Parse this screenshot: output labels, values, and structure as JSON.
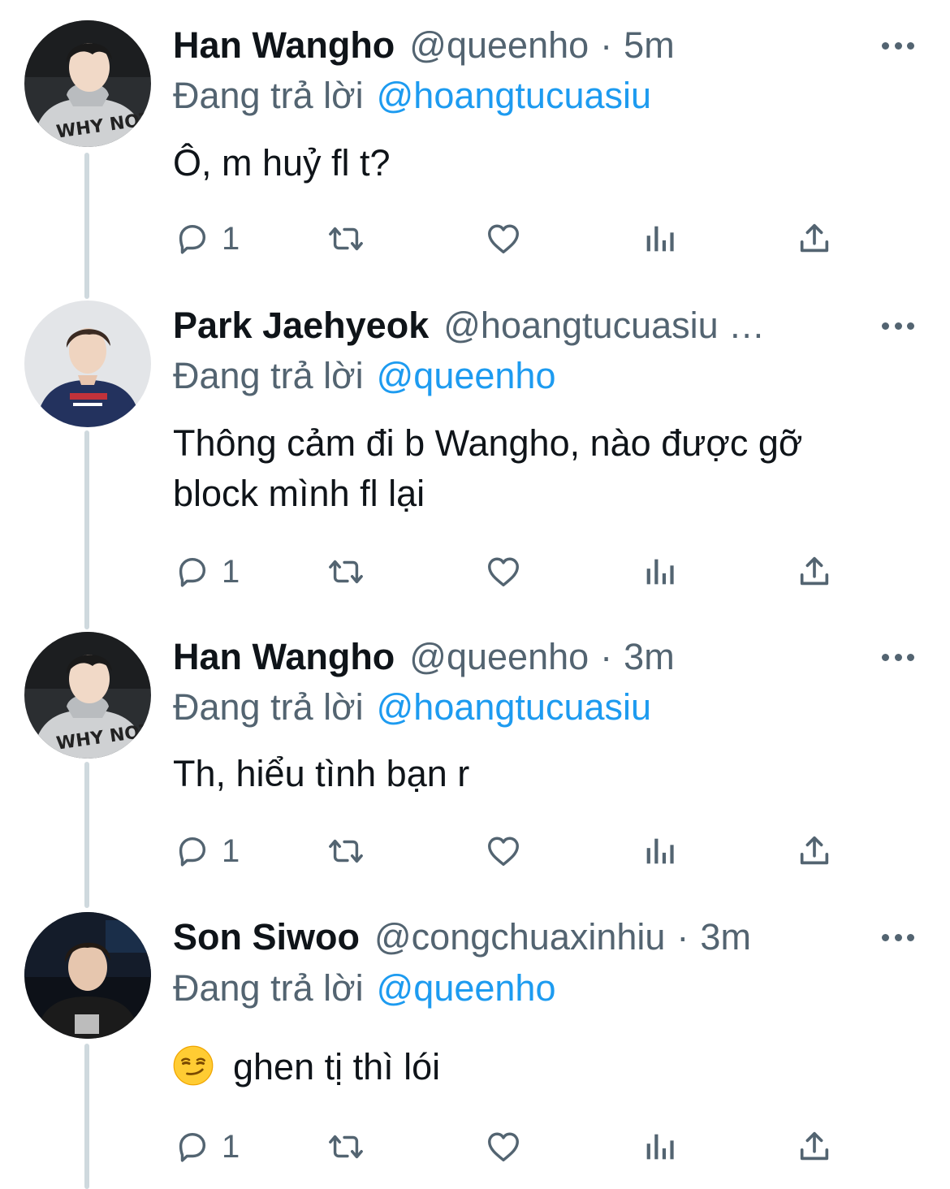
{
  "colors": {
    "text": "#0f1419",
    "secondary": "#536471",
    "link": "#1d9bf0",
    "thread_line": "#cfd9de"
  },
  "tweets": [
    {
      "display_name": "Han Wangho",
      "handle": "@queenho",
      "dot": "·",
      "time": "5m",
      "reply_label": "Đang trả lời",
      "reply_handle": "@hoangtucuasiu",
      "text": "Ô, m huỷ fl t?",
      "reply_count": "1",
      "avatar": "avatar-han-wangho"
    },
    {
      "display_name": "Park Jaehyeok",
      "handle": "@hoangtucuasiu …",
      "reply_label": "Đang trả lời",
      "reply_handle": "@queenho",
      "text": "Thông cảm đi b Wangho, nào được gỡ block mình fl lại",
      "reply_count": "1",
      "avatar": "avatar-park-jaehyeok"
    },
    {
      "display_name": "Han Wangho",
      "handle": "@queenho",
      "dot": "·",
      "time": "3m",
      "reply_label": "Đang trả lời",
      "reply_handle": "@hoangtucuasiu",
      "text": "Th, hiểu tình bạn r",
      "reply_count": "1",
      "avatar": "avatar-han-wangho"
    },
    {
      "display_name": "Son Siwoo",
      "handle": "@congchuaxinhiu",
      "dot": "·",
      "time": "3m",
      "reply_label": "Đang trả lời",
      "reply_handle": "@queenho",
      "emoji": "smirking-face-emoji",
      "text": "ghen tị thì lói",
      "reply_count": "1",
      "avatar": "avatar-son-siwoo"
    }
  ],
  "icons": {
    "reply": "reply-icon",
    "retweet": "retweet-icon",
    "like": "heart-icon",
    "views": "views-icon",
    "share": "share-icon",
    "more": "more-icon"
  }
}
